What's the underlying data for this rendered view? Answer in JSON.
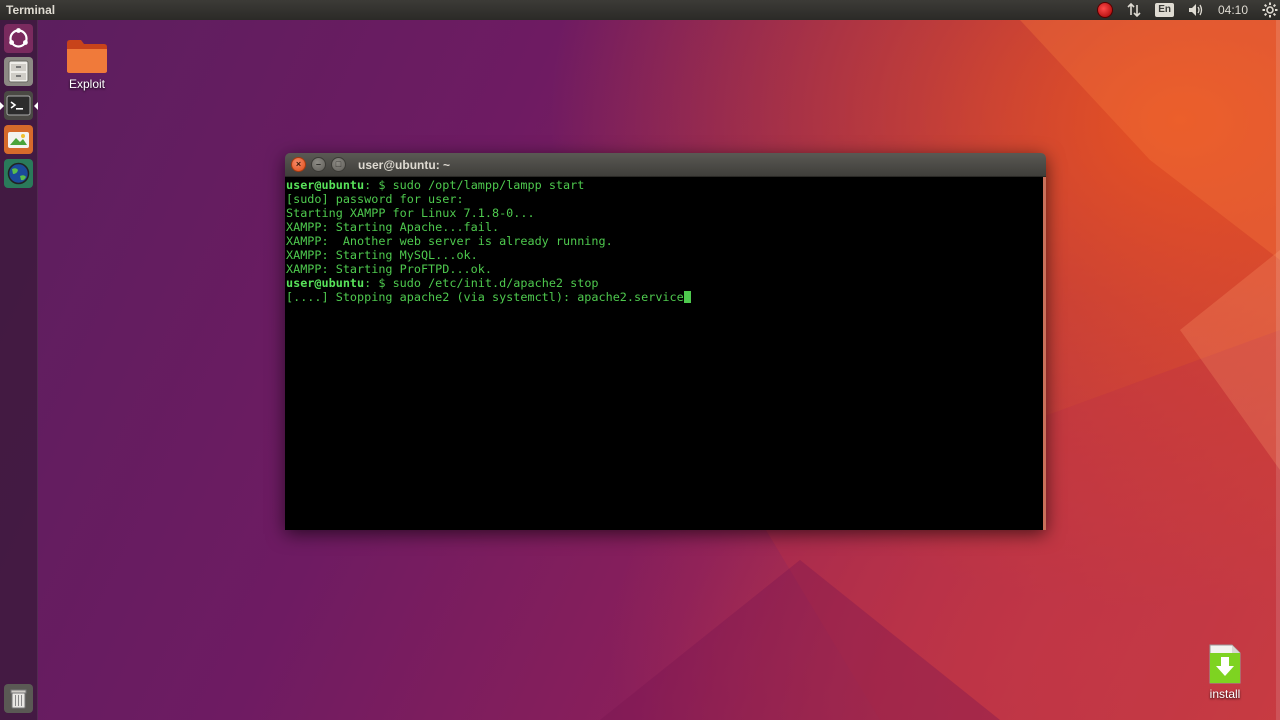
{
  "top_panel": {
    "app_title": "Terminal",
    "clock": "04:10",
    "language": "En",
    "icons": [
      "record-indicator-icon",
      "network-arrows-icon",
      "keyboard-language-icon",
      "volume-icon",
      "gear-icon"
    ]
  },
  "launcher": {
    "items": [
      {
        "name": "dash-home",
        "icon": "ubuntu-logo-icon"
      },
      {
        "name": "files",
        "icon": "file-cabinet-icon"
      },
      {
        "name": "terminal",
        "icon": "terminal-icon"
      },
      {
        "name": "image-viewer",
        "icon": "photo-viewer-icon"
      },
      {
        "name": "browser",
        "icon": "globe-icon"
      },
      {
        "name": "trash",
        "icon": "trash-icon"
      }
    ]
  },
  "desktop": {
    "icons": [
      {
        "label": "Exploit",
        "icon": "folder-icon"
      },
      {
        "label": "install",
        "icon": "download-file-icon"
      }
    ]
  },
  "terminal": {
    "title": "user@ubuntu: ~",
    "prompt_user": "user@ubuntu",
    "lines": [
      {
        "type": "prompt",
        "path": ": $ ",
        "command": "sudo /opt/lampp/lampp start"
      },
      {
        "type": "output",
        "text": "[sudo] password for user:"
      },
      {
        "type": "output",
        "text": "Starting XAMPP for Linux 7.1.8-0..."
      },
      {
        "type": "output",
        "text": "XAMPP: Starting Apache...fail."
      },
      {
        "type": "output",
        "text": "XAMPP:  Another web server is already running."
      },
      {
        "type": "output",
        "text": "XAMPP: Starting MySQL...ok."
      },
      {
        "type": "output",
        "text": "XAMPP: Starting ProFTPD...ok."
      },
      {
        "type": "prompt",
        "path": ": $ ",
        "command": "sudo /etc/init.d/apache2 stop"
      },
      {
        "type": "output",
        "text": "[....] Stopping apache2 (via systemctl): apache2.service",
        "cursor": true
      }
    ]
  },
  "colors": {
    "terminal_text": "#4ec94e",
    "terminal_bg": "#000000",
    "panel_bg": "#3c3b37",
    "ubuntu_orange": "#e95420"
  }
}
